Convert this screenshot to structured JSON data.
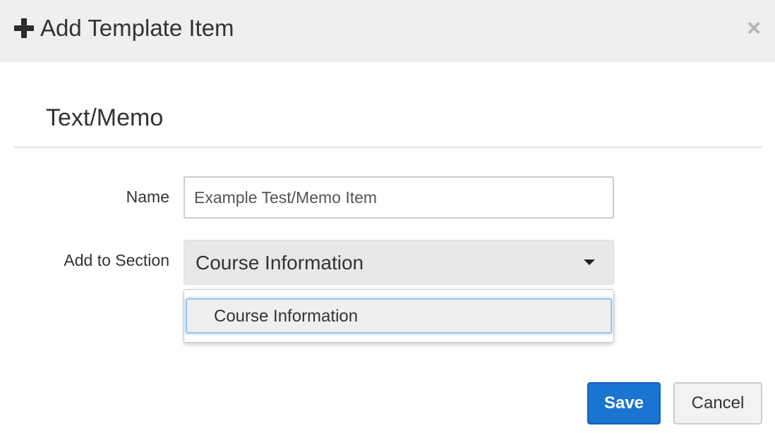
{
  "header": {
    "title": "Add Template Item",
    "icon": "plus-icon",
    "close_label": "×"
  },
  "section": {
    "heading": "Text/Memo"
  },
  "form": {
    "name_label": "Name",
    "name_value": "Example Test/Memo Item",
    "section_label": "Add to Section",
    "section_selected": "Course Information",
    "section_options": [
      "Course Information"
    ]
  },
  "footer": {
    "save_label": "Save",
    "cancel_label": "Cancel"
  },
  "colors": {
    "header_bg": "#efefef",
    "primary": "#1a74d1",
    "option_focus": "#9cc7ee"
  }
}
